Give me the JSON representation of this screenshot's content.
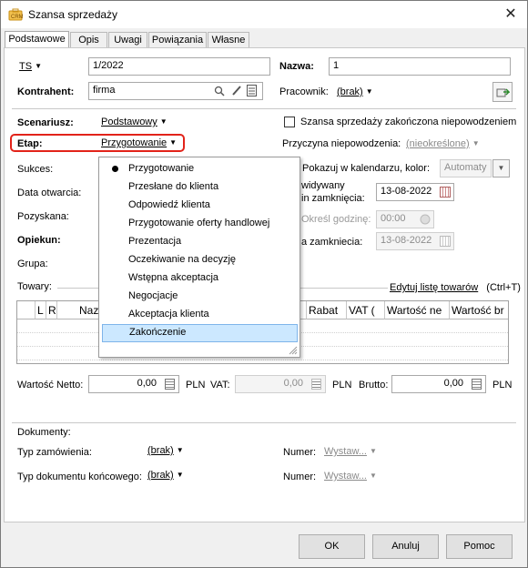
{
  "window": {
    "title": "Szansa sprzedaży",
    "close_glyph": "✕"
  },
  "tabs": [
    "Podstawowe",
    "Opis",
    "Uwagi",
    "Powiązania",
    "Własne"
  ],
  "form": {
    "series": "TS",
    "number": "1/2022",
    "nazwa_label": "Nazwa:",
    "nazwa_value": "1",
    "kontrahent_label": "Kontrahent:",
    "kontrahent_value": "firma",
    "pracownik_label": "Pracownik:",
    "pracownik_value": "(brak)",
    "scenariusz_label": "Scenariusz:",
    "scenariusz_value": "Podstawowy",
    "etap_label": "Etap:",
    "etap_value": "Przygotowanie",
    "failed_checkbox_label": "Szansa sprzedaży zakończona niepowodzeniem",
    "przyczyna_label": "Przyczyna niepowodzenia:",
    "przyczyna_value": "(nieokreślone)",
    "sukces_label": "Sukces:",
    "pokazuj_label": "Pokazuj w kalendarzu, kolor:",
    "pokazuj_value": "Automaty",
    "data_otwarcia_label": "Data otwarcia:",
    "przewidywany_line1": "widywany",
    "przewidywany_line2": "in zamknięcia:",
    "przewidywany_date": "13-08-2022",
    "pozyskana_label": "Pozyskana:",
    "okresl_label": "Określ godzinę:",
    "godzina_value": "00:00",
    "opiekun_label": "Opiekun:",
    "data_zamkniecia_label": "a zamkniecia:",
    "data_zamkniecia_value": "13-08-2022",
    "grupa_label": "Grupa:"
  },
  "towary": {
    "label": "Towary:",
    "edit_link": "Edytuj listę towarów",
    "shortcut": "(Ctrl+T)",
    "columns": [
      "L",
      "R",
      "Naz",
      "Rabat",
      "VAT (",
      "Wartość ne",
      "Wartość br"
    ]
  },
  "totals": {
    "netto_label": "Wartość Netto:",
    "netto_value": "0,00",
    "netto_currency": "PLN",
    "vat_label": "VAT:",
    "vat_value": "0,00",
    "vat_currency": "PLN",
    "brutto_label": "Brutto:",
    "brutto_value": "0,00",
    "brutto_currency": "PLN"
  },
  "dokumenty": {
    "label": "Dokumenty:",
    "typ_zam_label": "Typ zamówienia:",
    "typ_zam_value": "(brak)",
    "numer1_label": "Numer:",
    "numer1_value": "Wystaw...",
    "typ_konc_label": "Typ dokumentu końcowego:",
    "typ_konc_value": "(brak)",
    "numer2_label": "Numer:",
    "numer2_value": "Wystaw..."
  },
  "etap_menu": {
    "items": [
      "Przygotowanie",
      "Przesłane do klienta",
      "Odpowiedź klienta",
      "Przygotowanie oferty handlowej",
      "Prezentacja",
      "Oczekiwanie na decyzję",
      "Wstępna akceptacja",
      "Negocjacje",
      "Akceptacja klienta",
      "Zakończenie"
    ],
    "selected": "Przygotowanie",
    "highlighted": "Zakończenie"
  },
  "buttons": {
    "ok": "OK",
    "cancel": "Anuluj",
    "help": "Pomoc"
  },
  "colors": {
    "highlight_box": "#e2231a",
    "menu_hover": "#cce8ff"
  }
}
